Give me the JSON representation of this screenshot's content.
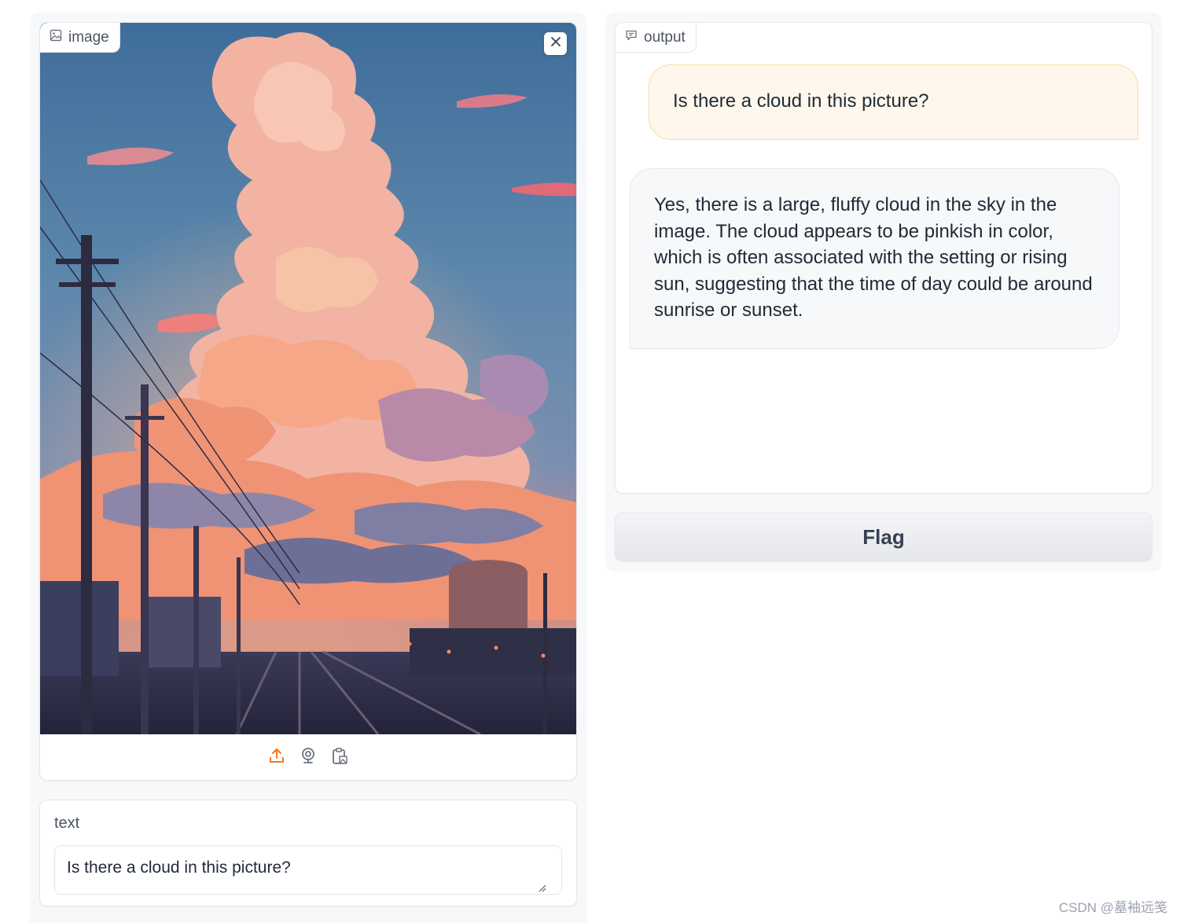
{
  "image_block": {
    "label": "image",
    "label_icon": "image-icon",
    "close_icon": "close-icon",
    "source_buttons": [
      {
        "name": "upload",
        "icon": "upload-icon",
        "color": "#f97316"
      },
      {
        "name": "webcam",
        "icon": "webcam-icon",
        "color": "#6b7280"
      },
      {
        "name": "clipboard",
        "icon": "clipboard-icon",
        "color": "#6b7280"
      }
    ]
  },
  "text_block": {
    "label": "text",
    "value": "Is there a cloud in this picture?"
  },
  "output_block": {
    "label": "output",
    "label_icon": "chat-icon",
    "messages": [
      {
        "role": "user",
        "text": "Is there a cloud in this picture?"
      },
      {
        "role": "bot",
        "text": "Yes, there is a large, fluffy cloud in the sky in the image. The cloud appears to be pinkish in color, which is often associated with the setting or rising sun, suggesting that the time of day could be around sunrise or sunset."
      }
    ]
  },
  "flag_button": {
    "label": "Flag"
  },
  "watermark": "CSDN @墓袖远笺",
  "colors": {
    "accent": "#f97316",
    "user_bubble": "#fff7ec",
    "user_border": "#fcd9a8",
    "bot_bubble": "#f7f8fa",
    "panel_bg": "#f7f8fa"
  }
}
